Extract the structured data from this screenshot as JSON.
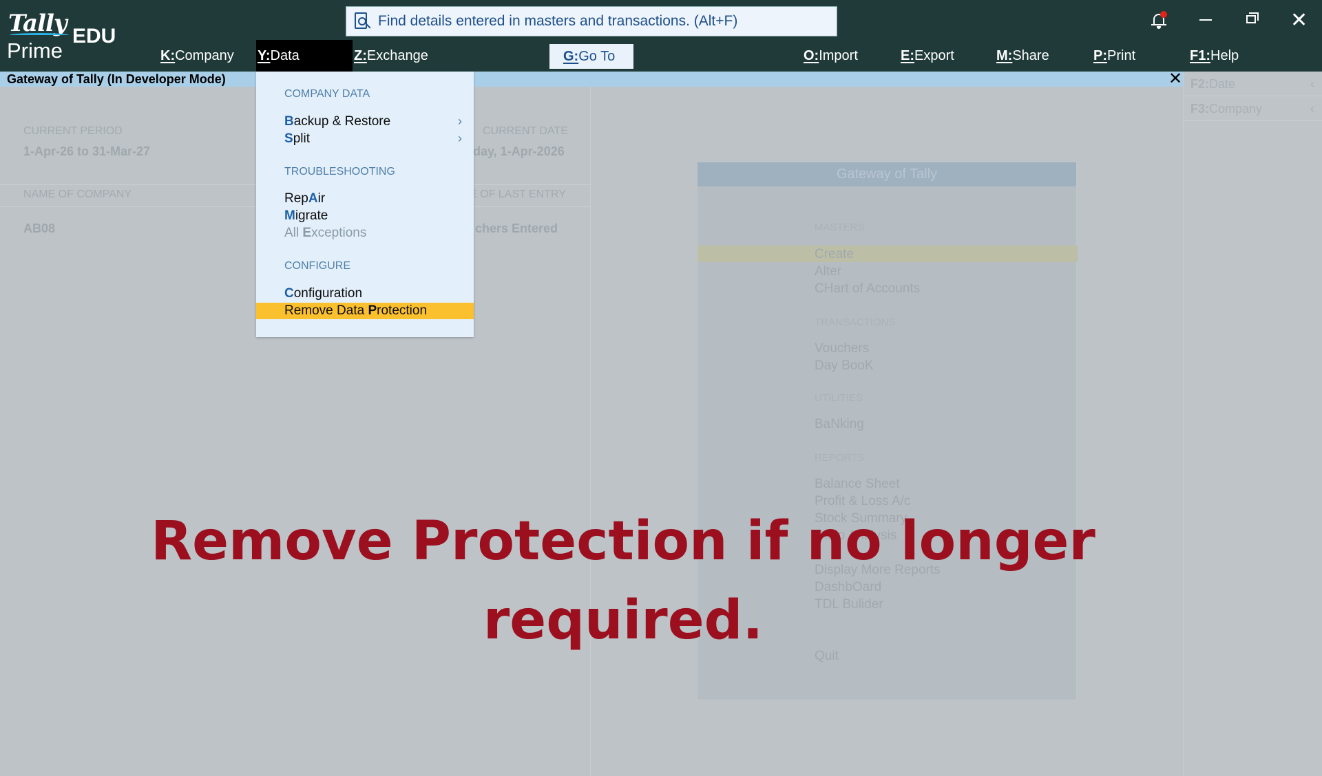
{
  "app": {
    "brand": "Tally",
    "product": "Prime",
    "edition": "EDU"
  },
  "search": {
    "placeholder": "Find details entered in masters and transactions. (Alt+F)"
  },
  "topmenu": {
    "company": {
      "key": "K:",
      "label": "Company"
    },
    "data": {
      "key": "Y:",
      "label": "Data"
    },
    "exchange": {
      "key": "Z:",
      "label": "Exchange"
    },
    "goto": {
      "key": "G:",
      "label": "Go To"
    },
    "import": {
      "key": "O:",
      "label": "Import"
    },
    "export": {
      "key": "E:",
      "label": "Export"
    },
    "share": {
      "key": "M:",
      "label": "Share"
    },
    "print": {
      "key": "P:",
      "label": "Print"
    },
    "help": {
      "key": "F1:",
      "label": "Help"
    }
  },
  "header": {
    "title": "Gateway of Tally (In Developer Mode)"
  },
  "company_info": {
    "current_period_label": "CURRENT PERIOD",
    "current_period": "1-Apr-26 to 31-Mar-27",
    "current_date_label": "CURRENT DATE",
    "current_date": "day, 1-Apr-2026",
    "name_label": "NAME OF COMPANY",
    "last_entry_label": "E OF LAST ENTRY",
    "company_name": "AB08",
    "last_entry": "chers Entered"
  },
  "right_panel": {
    "f2": {
      "key": "F2:",
      "label": "Date"
    },
    "f3": {
      "key": "F3:",
      "label": "Company"
    }
  },
  "gateway": {
    "title": "Gateway of Tally",
    "masters": "MASTERS",
    "create": "Create",
    "alter": "Alter",
    "chart": "CHart of Accounts",
    "transactions": "TRANSACTIONS",
    "vouchers": "Vouchers",
    "daybook": "Day BooK",
    "utilities": "UTILITIES",
    "banking": "BaNking",
    "reports": "REPORTS",
    "balance": "Balance Sheet",
    "pl": "Profit & Loss A/c",
    "stock": "Stock Summary",
    "ratio": "Ratio Analysis",
    "more": "Display More Reports",
    "dashboard": "DashbOard",
    "tdl": "TDL Bulider",
    "quit": "Quit"
  },
  "dropdown": {
    "company_data": "COMPANY DATA",
    "backup": {
      "hk": "B",
      "rest": "ackup & Restore"
    },
    "split": {
      "hk": "S",
      "rest": "plit"
    },
    "troubleshooting": "TROUBLESHOOTING",
    "repair": {
      "pre": "Rep",
      "hk": "A",
      "rest": "ir"
    },
    "migrate": {
      "hk": "M",
      "rest": "igrate"
    },
    "exceptions": {
      "pre": "All ",
      "hk": "E",
      "rest": "xceptions"
    },
    "configure": "CONFIGURE",
    "configuration": {
      "hk": "C",
      "rest": "onfiguration"
    },
    "remove": {
      "pre": "Remove Data ",
      "hk": "P",
      "rest": "rotection"
    }
  },
  "overlay_caption": "Remove Protection if no longer required.",
  "colors": {
    "titlebar": "#1f3a39",
    "header_bar": "#a9cfe8",
    "selected": "#fbc02d",
    "caption": "#9b0f1e"
  }
}
